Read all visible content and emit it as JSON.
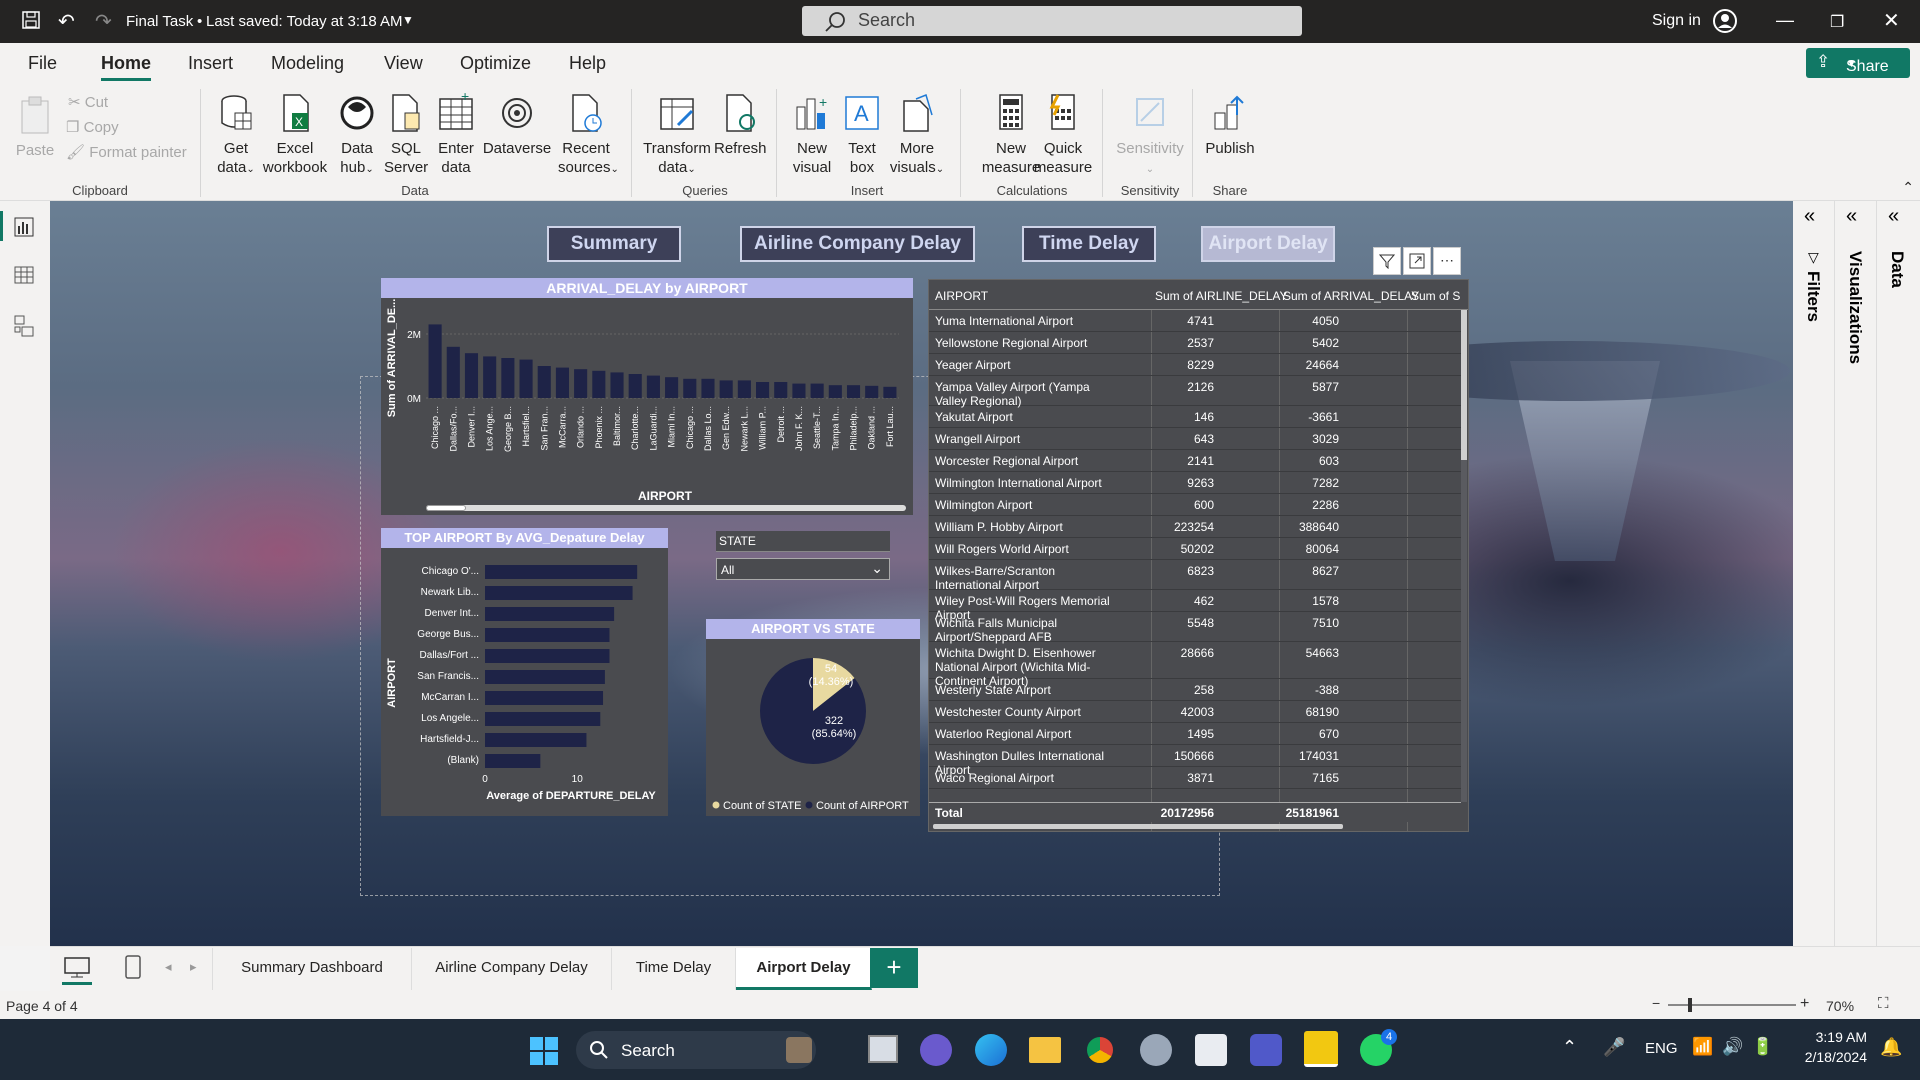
{
  "titlebar": {
    "doc_title": "Final Task",
    "saved": "Last saved: Today at 3:18 AM",
    "search_placeholder": "Search",
    "signin": "Sign in"
  },
  "menu": {
    "file": "File",
    "home": "Home",
    "insert": "Insert",
    "modeling": "Modeling",
    "view": "View",
    "optimize": "Optimize",
    "help": "Help",
    "share": "Share"
  },
  "ribbon": {
    "paste": "Paste",
    "cut": "Cut",
    "copy": "Copy",
    "format_painter": "Format painter",
    "clipboard": "Clipboard",
    "get_data": [
      "Get",
      "data"
    ],
    "excel": [
      "Excel",
      "workbook"
    ],
    "data_hub": [
      "Data",
      "hub"
    ],
    "sql": [
      "SQL",
      "Server"
    ],
    "enter_data": [
      "Enter",
      "data"
    ],
    "dataverse": "Dataverse",
    "recent": [
      "Recent",
      "sources"
    ],
    "data_group": "Data",
    "transform": [
      "Transform",
      "data"
    ],
    "refresh": "Refresh",
    "queries": "Queries",
    "new_visual": [
      "New",
      "visual"
    ],
    "text_box": [
      "Text",
      "box"
    ],
    "more_visuals": [
      "More",
      "visuals"
    ],
    "insert_group": "Insert",
    "new_measure": [
      "New",
      "measure"
    ],
    "quick_measure": [
      "Quick",
      "measure"
    ],
    "calculations": "Calculations",
    "sensitivity": "Sensitivity",
    "sensitivity_group": "Sensitivity",
    "publish": "Publish",
    "share_group": "Share"
  },
  "report": {
    "nav": {
      "summary": "Summary",
      "airline": "Airline Company Delay",
      "time": "Time Delay",
      "airport": "Airport Delay"
    },
    "state_slicer": {
      "label": "STATE",
      "value": "All"
    },
    "pie": {
      "title": "AIRPORT VS STATE",
      "slice1_value": "54",
      "slice1_pct": "(14.36%)",
      "slice2_value": "322",
      "slice2_pct": "(85.64%)",
      "legend1": "Count of STATE",
      "legend2": "Count of AIRPORT",
      "color1": "#e8d9a0",
      "color2": "#1e2347"
    },
    "table": {
      "headers": [
        "AIRPORT",
        "Sum of AIRLINE_DELAY",
        "Sum of ARRIVAL_DELAY",
        "Sum of S"
      ],
      "rows": [
        [
          "Yuma International Airport",
          "4741",
          "4050"
        ],
        [
          "Yellowstone Regional Airport",
          "2537",
          "5402"
        ],
        [
          "Yeager Airport",
          "8229",
          "24664"
        ],
        [
          "Yampa Valley Airport (Yampa Valley Regional)",
          "2126",
          "5877"
        ],
        [
          "Yakutat Airport",
          "146",
          "-3661"
        ],
        [
          "Wrangell Airport",
          "643",
          "3029"
        ],
        [
          "Worcester Regional Airport",
          "2141",
          "603"
        ],
        [
          "Wilmington International Airport",
          "9263",
          "7282"
        ],
        [
          "Wilmington Airport",
          "600",
          "2286"
        ],
        [
          "William P. Hobby Airport",
          "223254",
          "388640"
        ],
        [
          "Will Rogers World Airport",
          "50202",
          "80064"
        ],
        [
          "Wilkes-Barre/Scranton International Airport",
          "6823",
          "8627"
        ],
        [
          "Wiley Post-Will Rogers Memorial Airport",
          "462",
          "1578"
        ],
        [
          "Wichita Falls Municipal Airport/Sheppard AFB",
          "5548",
          "7510"
        ],
        [
          "Wichita Dwight D. Eisenhower National Airport (Wichita Mid-Continent Airport)",
          "28666",
          "54663"
        ],
        [
          "Westerly State Airport",
          "258",
          "-388"
        ],
        [
          "Westchester County Airport",
          "42003",
          "68190"
        ],
        [
          "Waterloo Regional Airport",
          "1495",
          "670"
        ],
        [
          "Washington Dulles International Airport",
          "150666",
          "174031"
        ],
        [
          "Waco Regional Airport",
          "3871",
          "7165"
        ]
      ],
      "total_label": "Total",
      "total_airline": "20172956",
      "total_arrival": "25181961"
    }
  },
  "chart_data": [
    {
      "type": "bar",
      "title": "ARRIVAL_DELAY by AIRPORT",
      "xlabel": "AIRPORT",
      "ylabel": "Sum of ARRIVAL_DE...",
      "yticks": [
        "2M",
        "0M"
      ],
      "categories": [
        "Chicago ...",
        "Dallas/Fo...",
        "Denver I...",
        "Los Ange...",
        "George B...",
        "Hartsfiel...",
        "San Fran...",
        "McCarra...",
        "Orlando ...",
        "Phoenix ...",
        "Baltimor...",
        "Charlotte...",
        "LaGuardi...",
        "Miami In...",
        "Chicago ...",
        "Dallas Lo...",
        "Gen Edw...",
        "Newark L...",
        "William P...",
        "Detroit ...",
        "John F. K...",
        "Seattle-T...",
        "Tampa In...",
        "Philadelp...",
        "Oakland ...",
        "Fort Lau..."
      ],
      "values": [
        2.3,
        1.6,
        1.4,
        1.3,
        1.25,
        1.2,
        1.0,
        0.95,
        0.9,
        0.85,
        0.8,
        0.75,
        0.7,
        0.65,
        0.6,
        0.6,
        0.55,
        0.55,
        0.5,
        0.5,
        0.45,
        0.45,
        0.4,
        0.4,
        0.38,
        0.35
      ],
      "unit": "M",
      "ylim": [
        0,
        2.5
      ]
    },
    {
      "type": "bar",
      "orientation": "horizontal",
      "title": "TOP AIRPORT By AVG_Depature Delay",
      "xlabel": "Average of DEPARTURE_DELAY",
      "ylabel": "AIRPORT",
      "categories": [
        "Chicago O'...",
        "Newark Lib...",
        "Denver Int...",
        "George Bus...",
        "Dallas/Fort ...",
        "San Francis...",
        "McCarran I...",
        "Los Angele...",
        "Hartsfield-J...",
        "(Blank)"
      ],
      "values": [
        16.5,
        16.0,
        14.0,
        13.5,
        13.5,
        13.0,
        12.8,
        12.5,
        11.0,
        6.0
      ],
      "xticks": [
        "0",
        "10"
      ],
      "xlim": [
        0,
        18
      ]
    },
    {
      "type": "pie",
      "title": "AIRPORT VS STATE",
      "labels": [
        "Count of STATE",
        "Count of AIRPORT"
      ],
      "values": [
        54,
        322
      ],
      "percent": [
        14.36,
        85.64
      ]
    }
  ],
  "pages": {
    "tabs": [
      "Summary Dashboard",
      "Airline Company Delay",
      "Time Delay",
      "Airport Delay"
    ],
    "active": 3,
    "page_indicator": "Page 4 of 4",
    "zoom": "70%"
  },
  "panes": {
    "filters": "Filters",
    "visualizations": "Visualizations",
    "data": "Data"
  },
  "taskbar": {
    "search": "Search",
    "lang": "ENG",
    "time": "3:19 AM",
    "date": "2/18/2024",
    "whatsapp_badge": "4"
  }
}
